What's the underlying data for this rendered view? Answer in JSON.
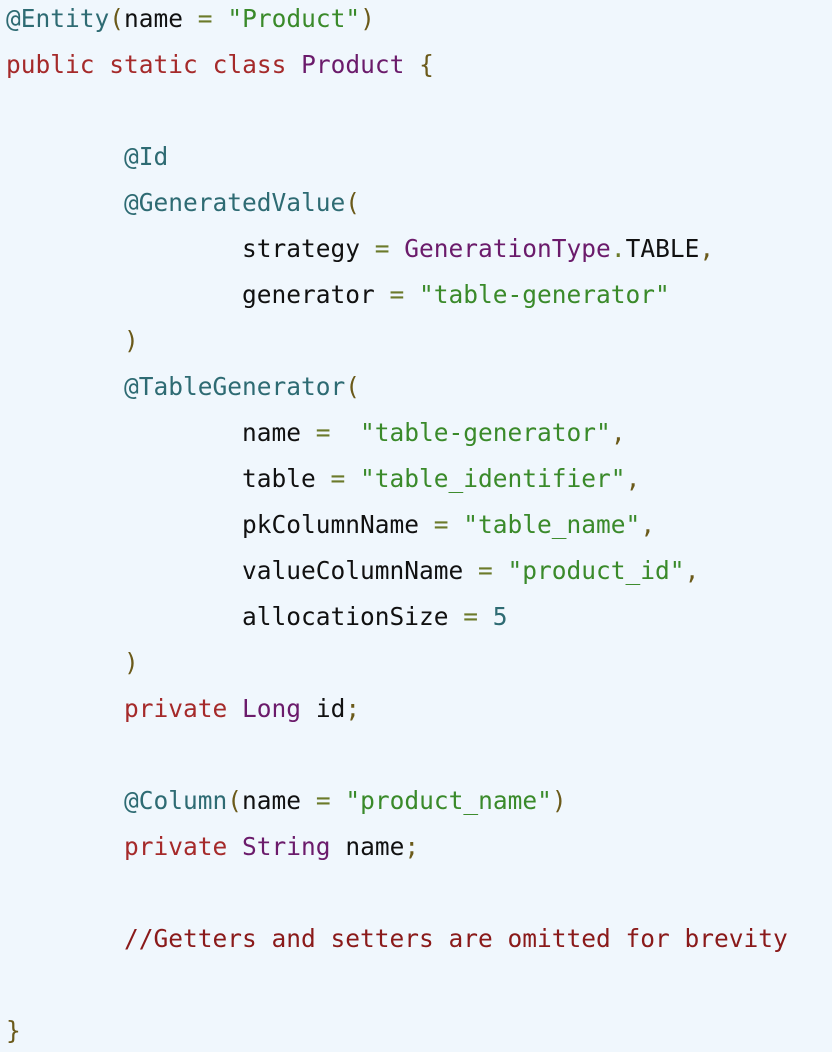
{
  "lines": [
    [
      {
        "t": "@Entity",
        "c": "ann"
      },
      {
        "t": "(",
        "c": "punc"
      },
      {
        "t": "name",
        "c": "plain"
      },
      {
        "t": " = ",
        "c": "op"
      },
      {
        "t": "\"Product\"",
        "c": "str"
      },
      {
        "t": ")",
        "c": "punc"
      }
    ],
    [
      {
        "t": "public",
        "c": "kw"
      },
      {
        "t": " ",
        "c": "plain"
      },
      {
        "t": "static",
        "c": "kw"
      },
      {
        "t": " ",
        "c": "plain"
      },
      {
        "t": "class",
        "c": "kw"
      },
      {
        "t": " ",
        "c": "plain"
      },
      {
        "t": "Product",
        "c": "ty"
      },
      {
        "t": " {",
        "c": "punc"
      }
    ],
    [],
    [
      {
        "t": "        ",
        "c": "plain"
      },
      {
        "t": "@Id",
        "c": "ann"
      }
    ],
    [
      {
        "t": "        ",
        "c": "plain"
      },
      {
        "t": "@GeneratedValue",
        "c": "ann"
      },
      {
        "t": "(",
        "c": "punc"
      }
    ],
    [
      {
        "t": "                ",
        "c": "plain"
      },
      {
        "t": "strategy",
        "c": "plain"
      },
      {
        "t": " = ",
        "c": "op"
      },
      {
        "t": "GenerationType",
        "c": "ty"
      },
      {
        "t": ".",
        "c": "op"
      },
      {
        "t": "TABLE",
        "c": "plain"
      },
      {
        "t": ",",
        "c": "punc"
      }
    ],
    [
      {
        "t": "                ",
        "c": "plain"
      },
      {
        "t": "generator",
        "c": "plain"
      },
      {
        "t": " = ",
        "c": "op"
      },
      {
        "t": "\"table-generator\"",
        "c": "str"
      }
    ],
    [
      {
        "t": "        ",
        "c": "plain"
      },
      {
        "t": ")",
        "c": "punc"
      }
    ],
    [
      {
        "t": "        ",
        "c": "plain"
      },
      {
        "t": "@TableGenerator",
        "c": "ann"
      },
      {
        "t": "(",
        "c": "punc"
      }
    ],
    [
      {
        "t": "                ",
        "c": "plain"
      },
      {
        "t": "name",
        "c": "plain"
      },
      {
        "t": " =  ",
        "c": "op"
      },
      {
        "t": "\"table-generator\"",
        "c": "str"
      },
      {
        "t": ",",
        "c": "punc"
      }
    ],
    [
      {
        "t": "                ",
        "c": "plain"
      },
      {
        "t": "table",
        "c": "plain"
      },
      {
        "t": " = ",
        "c": "op"
      },
      {
        "t": "\"table_identifier\"",
        "c": "str"
      },
      {
        "t": ",",
        "c": "punc"
      }
    ],
    [
      {
        "t": "                ",
        "c": "plain"
      },
      {
        "t": "pkColumnName",
        "c": "plain"
      },
      {
        "t": " = ",
        "c": "op"
      },
      {
        "t": "\"table_name\"",
        "c": "str"
      },
      {
        "t": ",",
        "c": "punc"
      }
    ],
    [
      {
        "t": "                ",
        "c": "plain"
      },
      {
        "t": "valueColumnName",
        "c": "plain"
      },
      {
        "t": " = ",
        "c": "op"
      },
      {
        "t": "\"product_id\"",
        "c": "str"
      },
      {
        "t": ",",
        "c": "punc"
      }
    ],
    [
      {
        "t": "                ",
        "c": "plain"
      },
      {
        "t": "allocationSize",
        "c": "plain"
      },
      {
        "t": " = ",
        "c": "op"
      },
      {
        "t": "5",
        "c": "num"
      }
    ],
    [
      {
        "t": "        ",
        "c": "plain"
      },
      {
        "t": ")",
        "c": "punc"
      }
    ],
    [
      {
        "t": "        ",
        "c": "plain"
      },
      {
        "t": "private",
        "c": "kw"
      },
      {
        "t": " ",
        "c": "plain"
      },
      {
        "t": "Long",
        "c": "ty"
      },
      {
        "t": " ",
        "c": "plain"
      },
      {
        "t": "id",
        "c": "plain"
      },
      {
        "t": ";",
        "c": "punc"
      }
    ],
    [],
    [
      {
        "t": "        ",
        "c": "plain"
      },
      {
        "t": "@Column",
        "c": "ann"
      },
      {
        "t": "(",
        "c": "punc"
      },
      {
        "t": "name",
        "c": "plain"
      },
      {
        "t": " = ",
        "c": "op"
      },
      {
        "t": "\"product_name\"",
        "c": "str"
      },
      {
        "t": ")",
        "c": "punc"
      }
    ],
    [
      {
        "t": "        ",
        "c": "plain"
      },
      {
        "t": "private",
        "c": "kw"
      },
      {
        "t": " ",
        "c": "plain"
      },
      {
        "t": "String",
        "c": "ty"
      },
      {
        "t": " ",
        "c": "plain"
      },
      {
        "t": "name",
        "c": "plain"
      },
      {
        "t": ";",
        "c": "punc"
      }
    ],
    [],
    [
      {
        "t": "        ",
        "c": "plain"
      },
      {
        "t": "//Getters and setters are omitted for brevity",
        "c": "cmt"
      }
    ],
    [],
    [
      {
        "t": "}",
        "c": "punc"
      }
    ]
  ]
}
